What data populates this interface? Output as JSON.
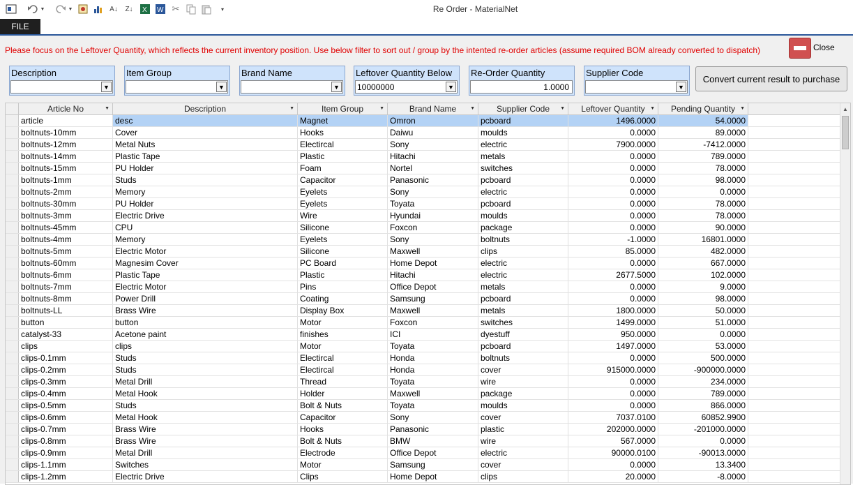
{
  "window": {
    "title": "Re Order - MaterialNet"
  },
  "quick_access": {
    "icons": [
      "app-icon",
      "undo-icon",
      "dropdown-icon",
      "redo-icon",
      "dropdown-icon",
      "report-icon",
      "chart-icon",
      "sort-asc-icon",
      "sort-desc-icon",
      "excel-icon",
      "word-icon",
      "cut-icon",
      "copy-icon",
      "paste-icon",
      "customize-icon"
    ]
  },
  "tabs": {
    "file": "FILE"
  },
  "instruction": "Please focus on the Leftover Quantity, which reflects the current inventory position. Use below filter to sort out / group by the intented re-order articles (assume required BOM already converted to dispatch)",
  "close": {
    "label": "Close"
  },
  "filters": {
    "description": {
      "label": "Description",
      "value": ""
    },
    "item_group": {
      "label": "Item Group",
      "value": ""
    },
    "brand_name": {
      "label": "Brand Name",
      "value": ""
    },
    "leftover_below": {
      "label": "Leftover Quantity Below",
      "value": "10000000"
    },
    "reorder_qty": {
      "label": "Re-Order Quantity",
      "value": "1.0000"
    },
    "supplier_code": {
      "label": "Supplier Code",
      "value": ""
    }
  },
  "convert_button": "Convert current result to purchase",
  "table": {
    "columns": [
      "Article No",
      "Description",
      "Item Group",
      "Brand Name",
      "Supplier Code",
      "Leftover Quantity",
      "Pending Quantity"
    ],
    "rows": [
      [
        "article",
        "desc",
        "Magnet",
        "Omron",
        "pcboard",
        "1496.0000",
        "54.0000"
      ],
      [
        "boltnuts-10mm",
        "Cover",
        "Hooks",
        "Daiwu",
        "moulds",
        "0.0000",
        "89.0000"
      ],
      [
        "boltnuts-12mm",
        "Metal Nuts",
        "Electircal",
        "Sony",
        "electric",
        "7900.0000",
        "-7412.0000"
      ],
      [
        "boltnuts-14mm",
        "Plastic Tape",
        "Plastic",
        "Hitachi",
        "metals",
        "0.0000",
        "789.0000"
      ],
      [
        "boltnuts-15mm",
        "PU Holder",
        "Foam",
        "Nortel",
        "switches",
        "0.0000",
        "78.0000"
      ],
      [
        "boltnuts-1mm",
        "Studs",
        "Capacitor",
        "Panasonic",
        "pcboard",
        "0.0000",
        "98.0000"
      ],
      [
        "boltnuts-2mm",
        "Memory",
        "Eyelets",
        "Sony",
        "electric",
        "0.0000",
        "0.0000"
      ],
      [
        "boltnuts-30mm",
        "PU Holder",
        "Eyelets",
        "Toyata",
        "pcboard",
        "0.0000",
        "78.0000"
      ],
      [
        "boltnuts-3mm",
        "Electric Drive",
        "Wire",
        "Hyundai",
        "moulds",
        "0.0000",
        "78.0000"
      ],
      [
        "boltnuts-45mm",
        "CPU",
        "Silicone",
        "Foxcon",
        "package",
        "0.0000",
        "90.0000"
      ],
      [
        "boltnuts-4mm",
        "Memory",
        "Eyelets",
        "Sony",
        "boltnuts",
        "-1.0000",
        "16801.0000"
      ],
      [
        "boltnuts-5mm",
        "Electric Motor",
        "Silicone",
        "Maxwell",
        "clips",
        "85.0000",
        "482.0000"
      ],
      [
        "boltnuts-60mm",
        "Magnesim Cover",
        "PC Board",
        "Home Depot",
        "electric",
        "0.0000",
        "667.0000"
      ],
      [
        "boltnuts-6mm",
        "Plastic Tape",
        "Plastic",
        "Hitachi",
        "electric",
        "2677.5000",
        "102.0000"
      ],
      [
        "boltnuts-7mm",
        "Electric Motor",
        "Pins",
        "Office Depot",
        "metals",
        "0.0000",
        "9.0000"
      ],
      [
        "boltnuts-8mm",
        "Power Drill",
        "Coating",
        "Samsung",
        "pcboard",
        "0.0000",
        "98.0000"
      ],
      [
        "boltnuts-LL",
        "Brass Wire",
        "Display Box",
        "Maxwell",
        "metals",
        "1800.0000",
        "50.0000"
      ],
      [
        "button",
        "button",
        "Motor",
        "Foxcon",
        "switches",
        "1499.0000",
        "51.0000"
      ],
      [
        "catalyst-33",
        "Acetone paint",
        "finishes",
        "ICI",
        "dyestuff",
        "950.0000",
        "0.0000"
      ],
      [
        "clips",
        "clips",
        "Motor",
        "Toyata",
        "pcboard",
        "1497.0000",
        "53.0000"
      ],
      [
        "clips-0.1mm",
        "Studs",
        "Electircal",
        "Honda",
        "boltnuts",
        "0.0000",
        "500.0000"
      ],
      [
        "clips-0.2mm",
        "Studs",
        "Electircal",
        "Honda",
        "cover",
        "915000.0000",
        "-900000.0000"
      ],
      [
        "clips-0.3mm",
        "Metal Drill",
        "Thread",
        "Toyata",
        "wire",
        "0.0000",
        "234.0000"
      ],
      [
        "clips-0.4mm",
        "Metal Hook",
        "Holder",
        "Maxwell",
        "package",
        "0.0000",
        "789.0000"
      ],
      [
        "clips-0.5mm",
        "Studs",
        "Bolt & Nuts",
        "Toyata",
        "moulds",
        "0.0000",
        "866.0000"
      ],
      [
        "clips-0.6mm",
        "Metal Hook",
        "Capacitor",
        "Sony",
        "cover",
        "7037.0100",
        "60852.9900"
      ],
      [
        "clips-0.7mm",
        "Brass Wire",
        "Hooks",
        "Panasonic",
        "plastic",
        "202000.0000",
        "-201000.0000"
      ],
      [
        "clips-0.8mm",
        "Brass Wire",
        "Bolt & Nuts",
        "BMW",
        "wire",
        "567.0000",
        "0.0000"
      ],
      [
        "clips-0.9mm",
        "Metal Drill",
        "Electrode",
        "Office Depot",
        "electric",
        "90000.0100",
        "-90013.0000"
      ],
      [
        "clips-1.1mm",
        "Switches",
        "Motor",
        "Samsung",
        "cover",
        "0.0000",
        "13.3400"
      ],
      [
        "clips-1.2mm",
        "Electric Drive",
        "Clips",
        "Home Depot",
        "clips",
        "20.0000",
        "-8.0000"
      ]
    ]
  }
}
